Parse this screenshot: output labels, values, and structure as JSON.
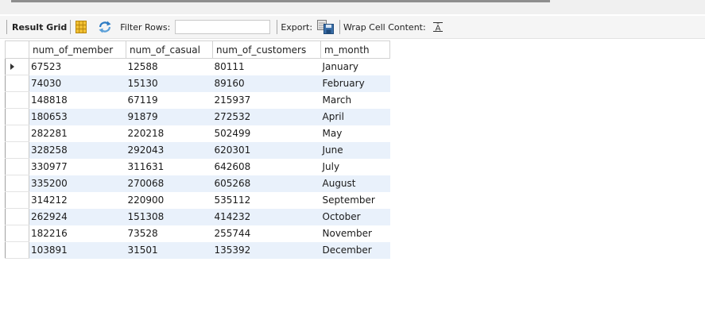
{
  "toolbar": {
    "result_grid_label": "Result Grid",
    "filter_rows_label": "Filter Rows:",
    "filter_value": "",
    "export_label": "Export:",
    "wrap_label": "Wrap Cell Content:"
  },
  "table": {
    "columns": [
      "num_of_member",
      "num_of_casual",
      "num_of_customers",
      "m_month"
    ],
    "rows": [
      [
        "67523",
        "12588",
        "80111",
        "January"
      ],
      [
        "74030",
        "15130",
        "89160",
        "February"
      ],
      [
        "148818",
        "67119",
        "215937",
        "March"
      ],
      [
        "180653",
        "91879",
        "272532",
        "April"
      ],
      [
        "282281",
        "220218",
        "502499",
        "May"
      ],
      [
        "328258",
        "292043",
        "620301",
        "June"
      ],
      [
        "330977",
        "311631",
        "642608",
        "July"
      ],
      [
        "335200",
        "270068",
        "605268",
        "August"
      ],
      [
        "314212",
        "220900",
        "535112",
        "September"
      ],
      [
        "262924",
        "151308",
        "414232",
        "October"
      ],
      [
        "182216",
        "73528",
        "255744",
        "November"
      ],
      [
        "103891",
        "31501",
        "135392",
        "December"
      ]
    ],
    "selected_row": 0
  }
}
